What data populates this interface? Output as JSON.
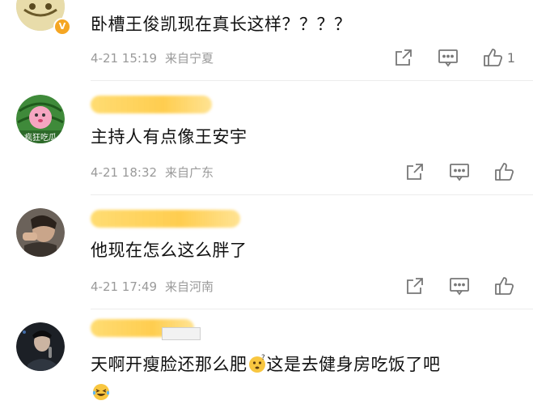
{
  "comments": [
    {
      "text": "卧槽王俊凯现在真长这样？？？？",
      "date": "4-21 15:19",
      "location": "来自宁夏",
      "likes": "1"
    },
    {
      "text": "主持人有点像王安宇",
      "date": "4-21 18:32",
      "location": "来自广东",
      "likes": ""
    },
    {
      "text": "他现在怎么这么胖了",
      "date": "4-21 17:49",
      "location": "来自河南",
      "likes": ""
    },
    {
      "text_part1": "天啊开瘦脸还那么肥",
      "text_part2": "这是去健身房吃饭了吧",
      "emoji1": "thinking-face",
      "emoji2": "laughing-tears-face"
    }
  ],
  "icons": {
    "share": "share-icon",
    "comment": "comment-icon",
    "like": "thumbs-up-icon"
  },
  "colors": {
    "meta_gray": "#9a9a9a",
    "name_highlight": "#ffd15a"
  }
}
